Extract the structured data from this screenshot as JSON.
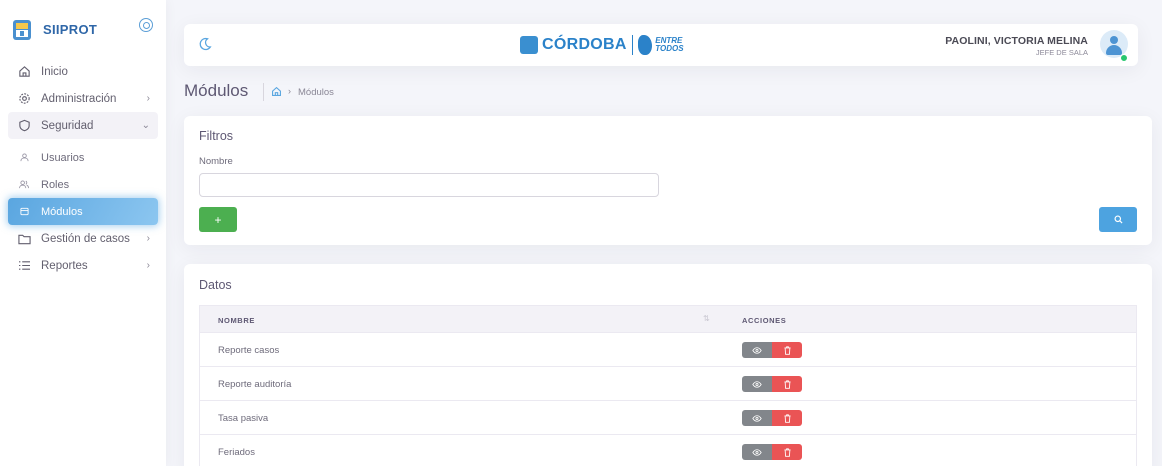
{
  "brand": {
    "name": "SIIPROT"
  },
  "sidebar": {
    "items": [
      {
        "label": "Inicio",
        "icon": "home-icon"
      },
      {
        "label": "Administración",
        "icon": "settings-icon"
      },
      {
        "label": "Seguridad",
        "icon": "shield-icon"
      },
      {
        "label": "Usuarios",
        "icon": "user-icon"
      },
      {
        "label": "Roles",
        "icon": "users-icon"
      },
      {
        "label": "Módulos",
        "icon": "module-icon"
      },
      {
        "label": "Gestión de casos",
        "icon": "folder-icon"
      },
      {
        "label": "Reportes",
        "icon": "list-icon"
      }
    ]
  },
  "header": {
    "logo_text": "CÓRDOBA",
    "logo_tagline_1": "ENTRE",
    "logo_tagline_2": "TODOS",
    "user_name": "PAOLINI, VICTORIA MELINA",
    "user_role": "JEFE DE SALA"
  },
  "page": {
    "title": "Módulos",
    "breadcrumb_current": "Módulos"
  },
  "filters": {
    "title": "Filtros",
    "name_label": "Nombre",
    "name_value": "",
    "add_label": "+"
  },
  "data": {
    "title": "Datos",
    "columns": [
      "NOMBRE",
      "ACCIONES"
    ],
    "rows": [
      {
        "name": "Reporte casos"
      },
      {
        "name": "Reporte auditoría"
      },
      {
        "name": "Tasa pasiva"
      },
      {
        "name": "Feriados"
      }
    ]
  },
  "colors": {
    "accent": "#5aa6e0",
    "success": "#4caf50",
    "danger": "#ea5455",
    "secondary": "#82868b"
  }
}
